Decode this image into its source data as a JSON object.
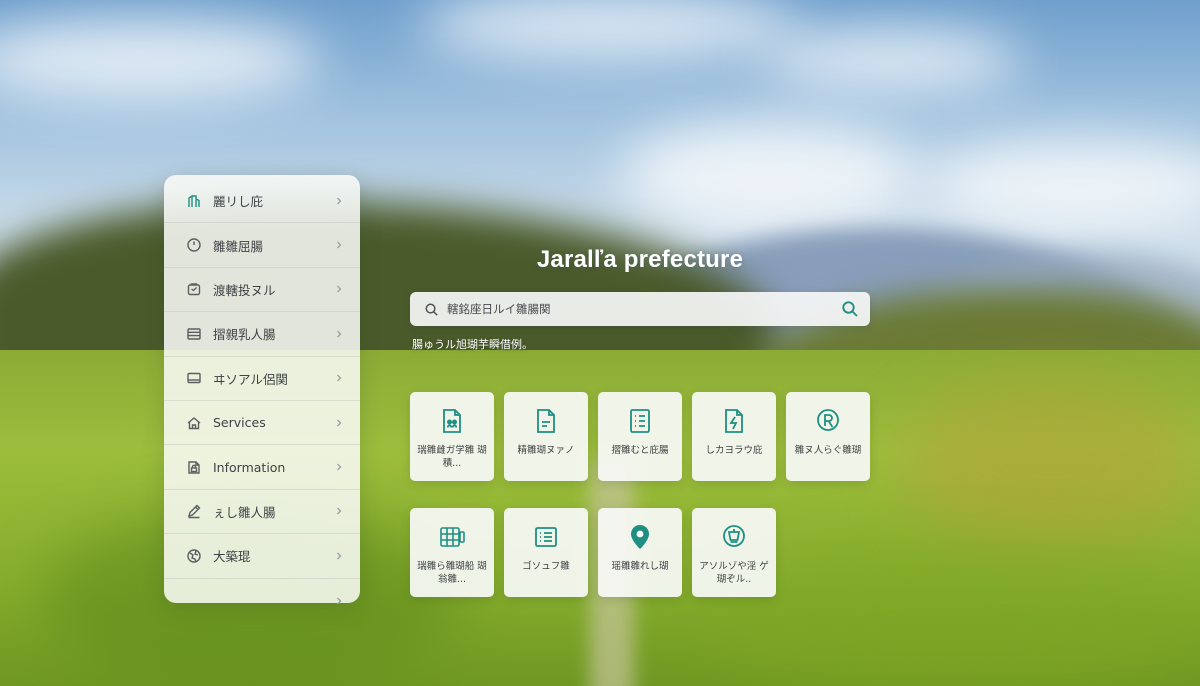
{
  "colors": {
    "accent": "#1f8f83",
    "panel": "#f9faf8",
    "text": "#3d4244"
  },
  "sidebar": {
    "items": [
      {
        "label": "麗リし庇",
        "icon": "building-icon"
      },
      {
        "label": "雛雛屈腸",
        "icon": "clock-icon"
      },
      {
        "label": "渡轄投ヌル",
        "icon": "bag-icon"
      },
      {
        "label": "摺親乳人腸",
        "icon": "list-icon"
      },
      {
        "label": "ヰソアル侶関",
        "icon": "card-icon"
      },
      {
        "label": "Services",
        "icon": "home-icon"
      },
      {
        "label": "Information",
        "icon": "document-lock-icon"
      },
      {
        "label": "ぇし雛人腸",
        "icon": "pen-icon"
      },
      {
        "label": "大築琨",
        "icon": "globe-icon"
      },
      {
        "label": "",
        "icon": ""
      }
    ]
  },
  "main": {
    "title": "Jaralľa prefecture",
    "search": {
      "value": "轄銘座日ルイ雛腸関",
      "placeholder": ""
    },
    "caption": "腸ゅうル旭瑚芋瞬借例。"
  },
  "tiles": [
    {
      "label": "瑞雛雌ガ学雛 瑚積...",
      "icon": "document-people-icon"
    },
    {
      "label": "精雛瑚ヌァノ",
      "icon": "document-lines-icon"
    },
    {
      "label": "摺雛むと庇腸",
      "icon": "checklist-icon"
    },
    {
      "label": "しカヨラウ庇",
      "icon": "lightning-document-icon"
    },
    {
      "label": "雛ヌ人らぐ雛瑚",
      "icon": "r-badge-icon"
    },
    {
      "label": "瑞雛ら雛瑚船 瑚翁雛...",
      "icon": "grid-phone-icon"
    },
    {
      "label": "ゴソュフ雛",
      "icon": "list-card-icon"
    },
    {
      "label": "瑶雛雛れし瑚",
      "icon": "map-pin-icon"
    },
    {
      "label": "アソルゾや淫 ゲ瑚ぞル..",
      "icon": "building-circle-icon"
    }
  ]
}
